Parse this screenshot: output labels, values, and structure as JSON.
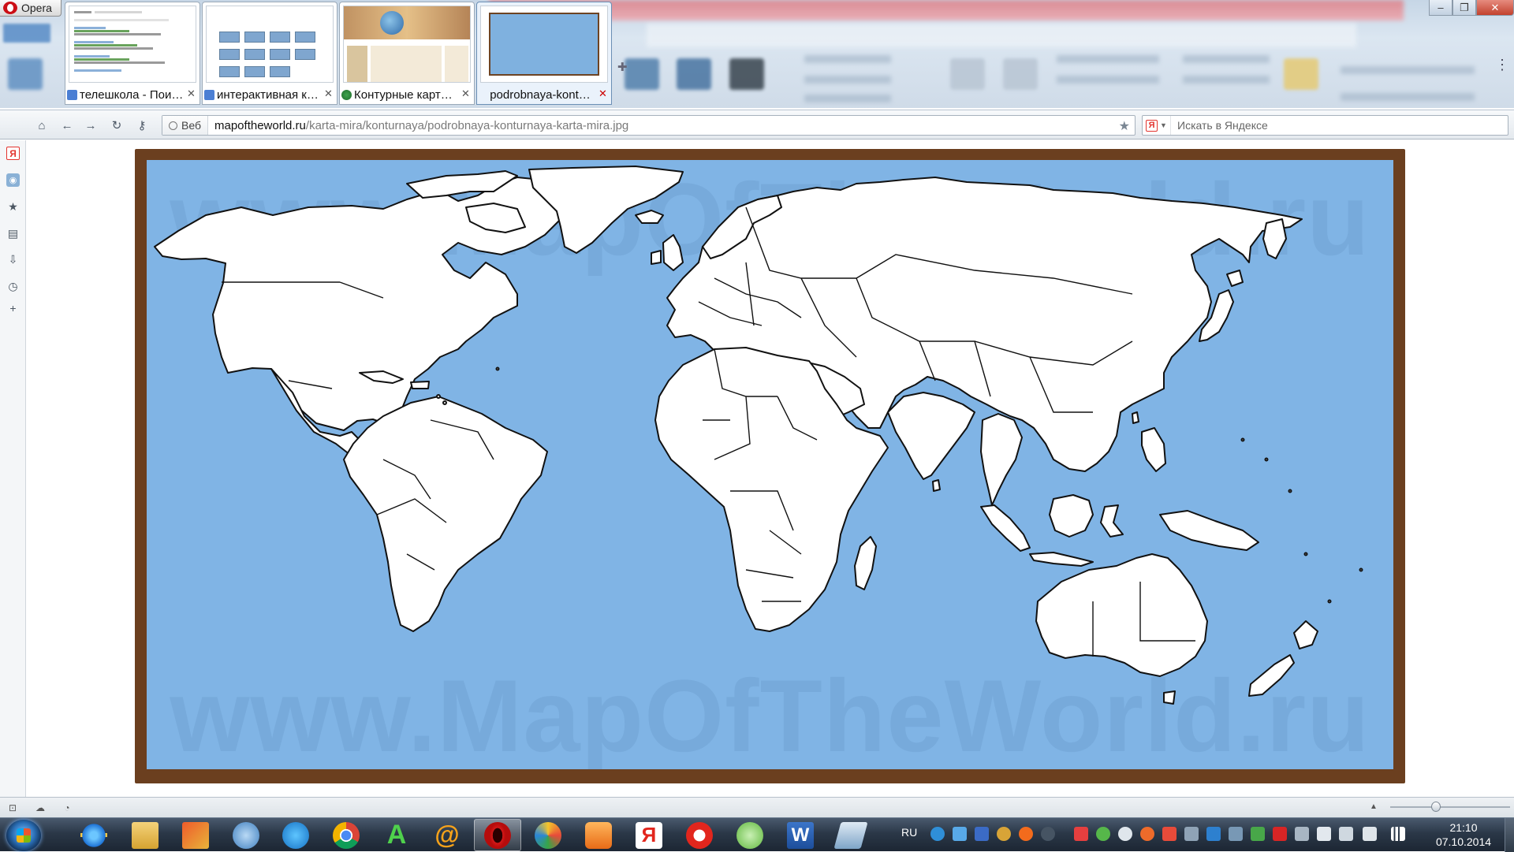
{
  "browser": {
    "menu_label": "Opera",
    "tabs": [
      {
        "title": "телешкола - Пои…",
        "active": false,
        "favicon": "google-g-icon"
      },
      {
        "title": "интерактивная к…",
        "active": false,
        "favicon": "google-g-icon"
      },
      {
        "title": "Контурные карт…",
        "active": false,
        "favicon": "globe-icon"
      },
      {
        "title": "podrobnaya-kont…",
        "active": true,
        "favicon": "none"
      }
    ],
    "address": {
      "scope_label": "Веб",
      "url_host": "mapoftheworld.ru",
      "url_path": "/karta-mira/konturnaya/podrobnaya-konturnaya-karta-mira.jpg"
    },
    "search": {
      "engine_letter": "Я",
      "placeholder": "Искать в Яндексе"
    },
    "sidebar_icons": [
      "yandex-icon",
      "speed-dial-icon",
      "bookmarks-star-icon",
      "notes-icon",
      "downloads-icon",
      "history-icon",
      "add-panel-icon"
    ],
    "zoom_level": 0.37
  },
  "page": {
    "image_watermark": "www.MapOfTheWorld.ru",
    "colors": {
      "ocean": "#80b4e5",
      "frame": "#6b3f1f",
      "land": "#ffffff",
      "border": "#111111"
    }
  },
  "taskbar": {
    "apps": [
      "internet-explorer-icon",
      "file-explorer-icon",
      "ms-office-icon",
      "audio-icon",
      "skype-like-icon",
      "chrome-icon",
      "font-a-icon",
      "mail-agent-icon",
      "opera-icon",
      "app-colorful-icon",
      "media-player-icon",
      "yandex-browser-icon",
      "yandex-icon",
      "utorrent-icon",
      "word-icon",
      "notebook-icon"
    ],
    "language": "RU",
    "time": "21:10",
    "date": "07.10.2014"
  }
}
